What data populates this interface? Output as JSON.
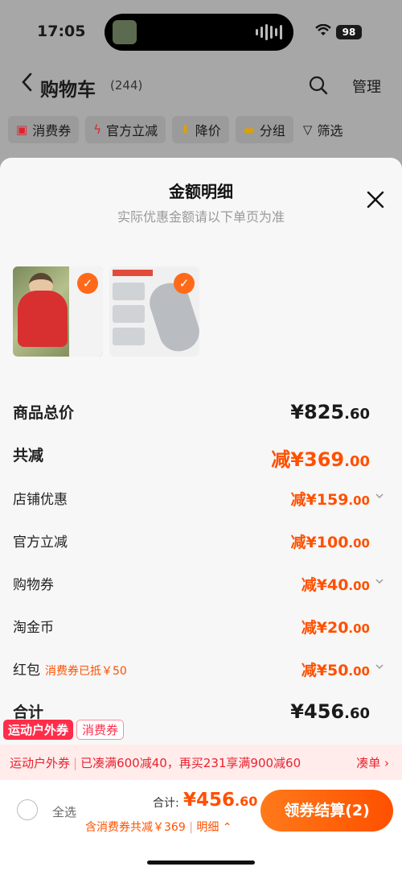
{
  "status_bar": {
    "time": "17:05",
    "battery": "98"
  },
  "nav": {
    "title": "购物车",
    "count": "(244)",
    "manage": "管理"
  },
  "filters": [
    {
      "label": "消费券",
      "icon": "ticket-icon"
    },
    {
      "label": "官方立减",
      "icon": "lightning-icon"
    },
    {
      "label": "降价",
      "icon": "arrow-down-icon"
    },
    {
      "label": "分组",
      "icon": "folder-icon"
    },
    {
      "label": "筛选",
      "icon": "filter-icon"
    }
  ],
  "sheet": {
    "title": "金额明细",
    "subtitle": "实际优惠金额请以下单页为准"
  },
  "rows": {
    "subtotal": {
      "label": "商品总价",
      "prefix": "¥",
      "int": "825",
      "dec": ".60"
    },
    "reduce": {
      "label": "共减",
      "prefix": "减¥",
      "int": "369",
      "dec": ".00"
    },
    "shop": {
      "label": "店铺优惠",
      "prefix": "减¥",
      "int": "159",
      "dec": ".00"
    },
    "official": {
      "label": "官方立减",
      "prefix": "减¥",
      "int": "100",
      "dec": ".00"
    },
    "coupon": {
      "label": "购物券",
      "prefix": "减¥",
      "int": "40",
      "dec": ".00"
    },
    "gold": {
      "label": "淘金币",
      "prefix": "减¥",
      "int": "20",
      "dec": ".00"
    },
    "redpacket": {
      "label": "红包",
      "note": "消费券已抵￥50",
      "prefix": "减¥",
      "int": "50",
      "dec": ".00"
    },
    "total": {
      "label": "合计",
      "prefix": "¥",
      "int": "456",
      "dec": ".60"
    }
  },
  "tags": {
    "outdoor": "运动户外券",
    "consume": "消费券"
  },
  "promo": {
    "name": "运动户外券",
    "text": "已凑满600减40，再买231享满900减60",
    "link": "凑单 ›"
  },
  "bottom": {
    "select_all": "全选",
    "total_label": "合计:",
    "total_prefix": "¥",
    "total_int": "456",
    "total_dec": ".60",
    "sub": "含消费券共减￥369",
    "detail": "明细 ⌃",
    "checkout": "领券结算(2)"
  },
  "colors": {
    "accent": "#ff5000",
    "promo_red": "#e8232f"
  }
}
